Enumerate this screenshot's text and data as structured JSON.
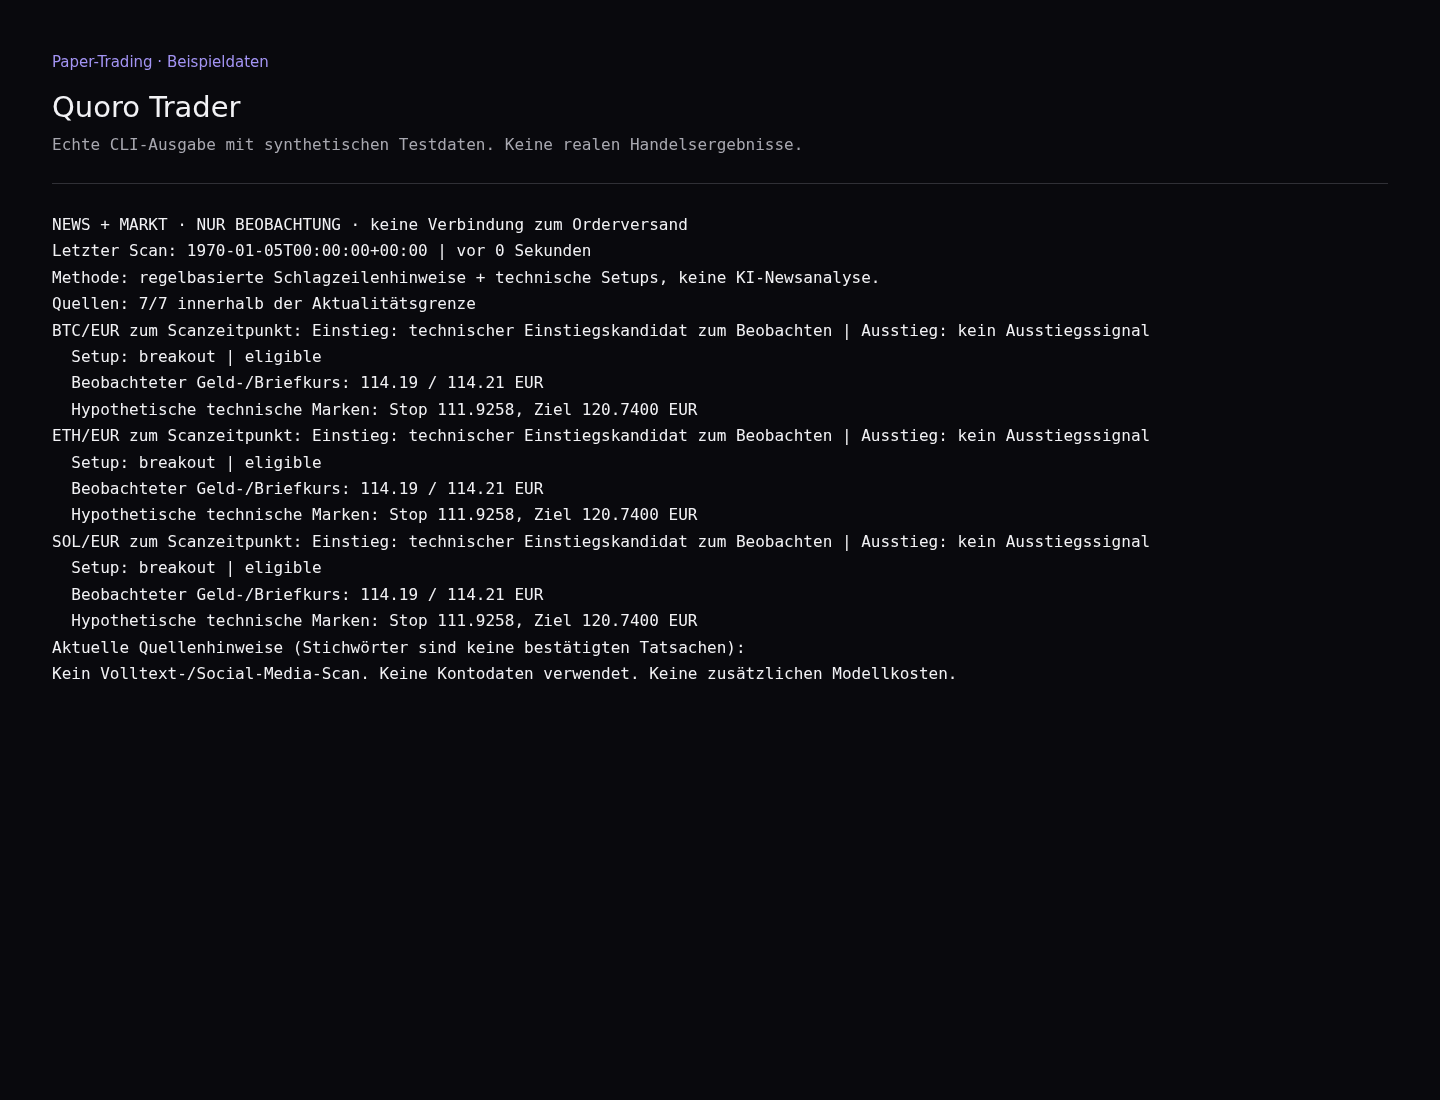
{
  "header": {
    "eyebrow": "Paper-Trading · Beispieldaten",
    "title": "Quoro Trader",
    "subtitle": "Echte CLI-Ausgabe mit synthetischen Testdaten. Keine realen Handelsergebnisse."
  },
  "output_lines": [
    "NEWS + MARKT · NUR BEOBACHTUNG · keine Verbindung zum Orderversand",
    "Letzter Scan: 1970-01-05T00:00:00+00:00 | vor 0 Sekunden",
    "Methode: regelbasierte Schlagzeilenhinweise + technische Setups, keine KI-Newsanalyse.",
    "Quellen: 7/7 innerhalb der Aktualitätsgrenze",
    "BTC/EUR zum Scanzeitpunkt: Einstieg: technischer Einstiegskandidat zum Beobachten | Ausstieg: kein Ausstiegssignal",
    "  Setup: breakout | eligible",
    "  Beobachteter Geld-/Briefkurs: 114.19 / 114.21 EUR",
    "  Hypothetische technische Marken: Stop 111.9258, Ziel 120.7400 EUR",
    "ETH/EUR zum Scanzeitpunkt: Einstieg: technischer Einstiegskandidat zum Beobachten | Ausstieg: kein Ausstiegssignal",
    "  Setup: breakout | eligible",
    "  Beobachteter Geld-/Briefkurs: 114.19 / 114.21 EUR",
    "  Hypothetische technische Marken: Stop 111.9258, Ziel 120.7400 EUR",
    "SOL/EUR zum Scanzeitpunkt: Einstieg: technischer Einstiegskandidat zum Beobachten | Ausstieg: kein Ausstiegssignal",
    "  Setup: breakout | eligible",
    "  Beobachteter Geld-/Briefkurs: 114.19 / 114.21 EUR",
    "  Hypothetische technische Marken: Stop 111.9258, Ziel 120.7400 EUR",
    "Aktuelle Quellenhinweise (Stichwörter sind keine bestätigten Tatsachen):",
    "Kein Volltext-/Social-Media-Scan. Keine Kontodaten verwendet. Keine zusätzlichen Modellkosten."
  ]
}
